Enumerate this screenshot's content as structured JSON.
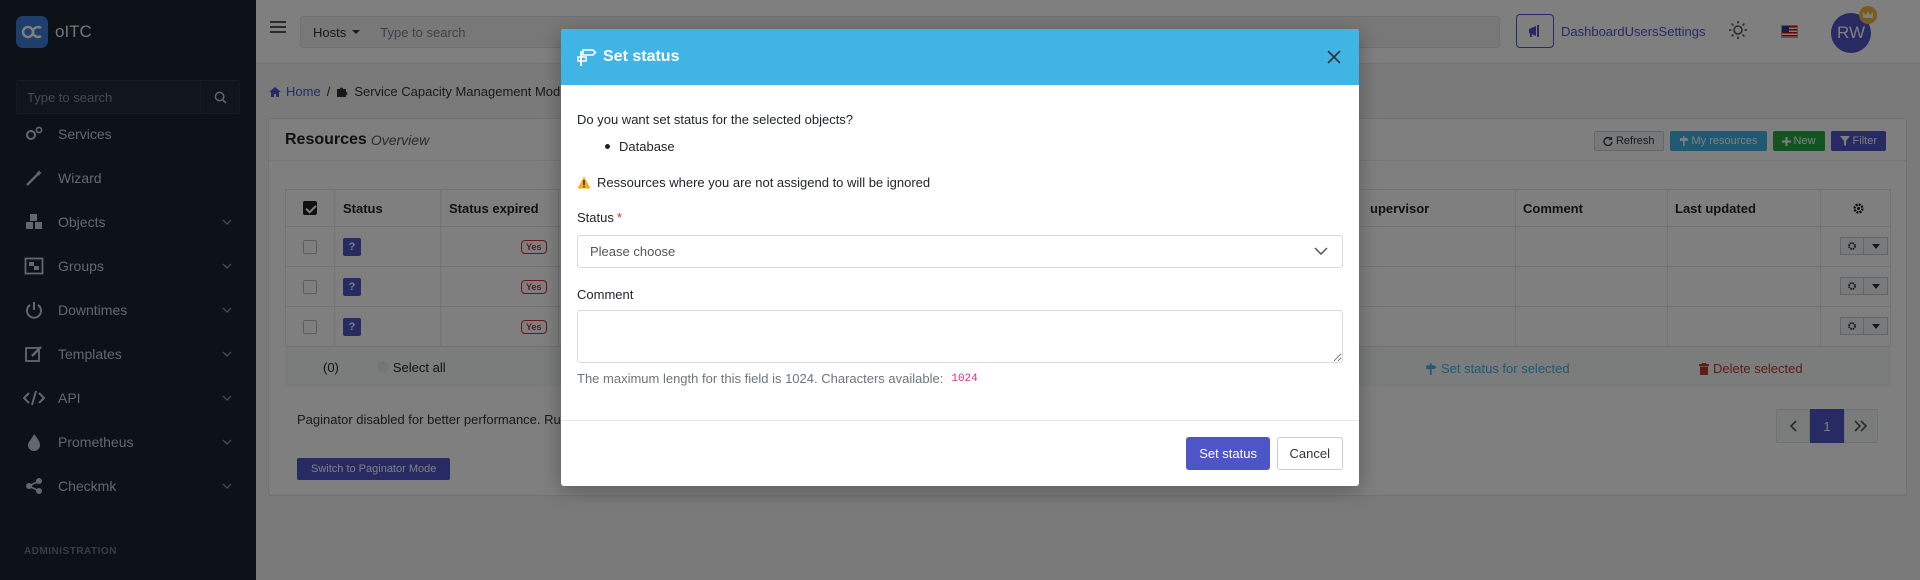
{
  "app": {
    "name": "oITC",
    "logo_text": "C"
  },
  "sidebar": {
    "search_placeholder": "Type to search",
    "items": [
      {
        "label": "Services",
        "icon": "gears-icon"
      },
      {
        "label": "Wizard",
        "icon": "wand-icon"
      },
      {
        "label": "Objects",
        "icon": "cubes-icon"
      },
      {
        "label": "Groups",
        "icon": "object-group-icon"
      },
      {
        "label": "Downtimes",
        "icon": "power-icon"
      },
      {
        "label": "Templates",
        "icon": "edit-icon"
      },
      {
        "label": "API",
        "icon": "code-icon"
      },
      {
        "label": "Prometheus",
        "icon": "fire-icon"
      },
      {
        "label": "Checkmk",
        "icon": "share-nodes-icon"
      }
    ],
    "section_label": "ADMINISTRATION"
  },
  "topbar": {
    "hosts_label": "Hosts",
    "search_placeholder": "Type to search",
    "links": "DashboardUsersSettings",
    "avatar_initials": "RW"
  },
  "breadcrumb": {
    "home": "Home",
    "current": "Service Capacity Management Mod"
  },
  "card": {
    "title": "Resources",
    "subtitle": "Overview",
    "buttons": {
      "refresh": "Refresh",
      "my_resources": "My resources",
      "new": "New",
      "filter": "Filter"
    },
    "table": {
      "headers": {
        "status": "Status",
        "status_expired": "Status expired",
        "supervisor": "upervisor",
        "comment": "Comment",
        "last_updated": "Last updated"
      },
      "rows": [
        {
          "status": "?",
          "expired": "Yes"
        },
        {
          "status": "?",
          "expired": "Yes"
        },
        {
          "status": "?",
          "expired": "Yes"
        }
      ],
      "footer": {
        "count": "(0)",
        "select_all": "Select all",
        "set_status_selected": "Set status for selected",
        "delete_selected": "Delete selected"
      }
    },
    "paginator_text": "Paginator disabled for better performance. Ru",
    "switch_button": "Switch to Paginator Mode",
    "pager": {
      "current": "1"
    }
  },
  "modal": {
    "title": "Set status",
    "question": "Do you want set status for the selected objects?",
    "objects": [
      "Database"
    ],
    "warning": "Ressources where you are not assigend to will be ignored",
    "status_label": "Status",
    "required_mark": "*",
    "status_placeholder": "Please choose",
    "comment_label": "Comment",
    "hint": "The maximum length for this field is 1024. Characters available:",
    "chars_available": "1024",
    "submit": "Set status",
    "cancel": "Cancel"
  },
  "colors": {
    "accent": "#4e55c6",
    "info": "#3fb4e5",
    "sidebar": "#1b2430",
    "danger": "#c0392b",
    "success": "#27a844"
  }
}
